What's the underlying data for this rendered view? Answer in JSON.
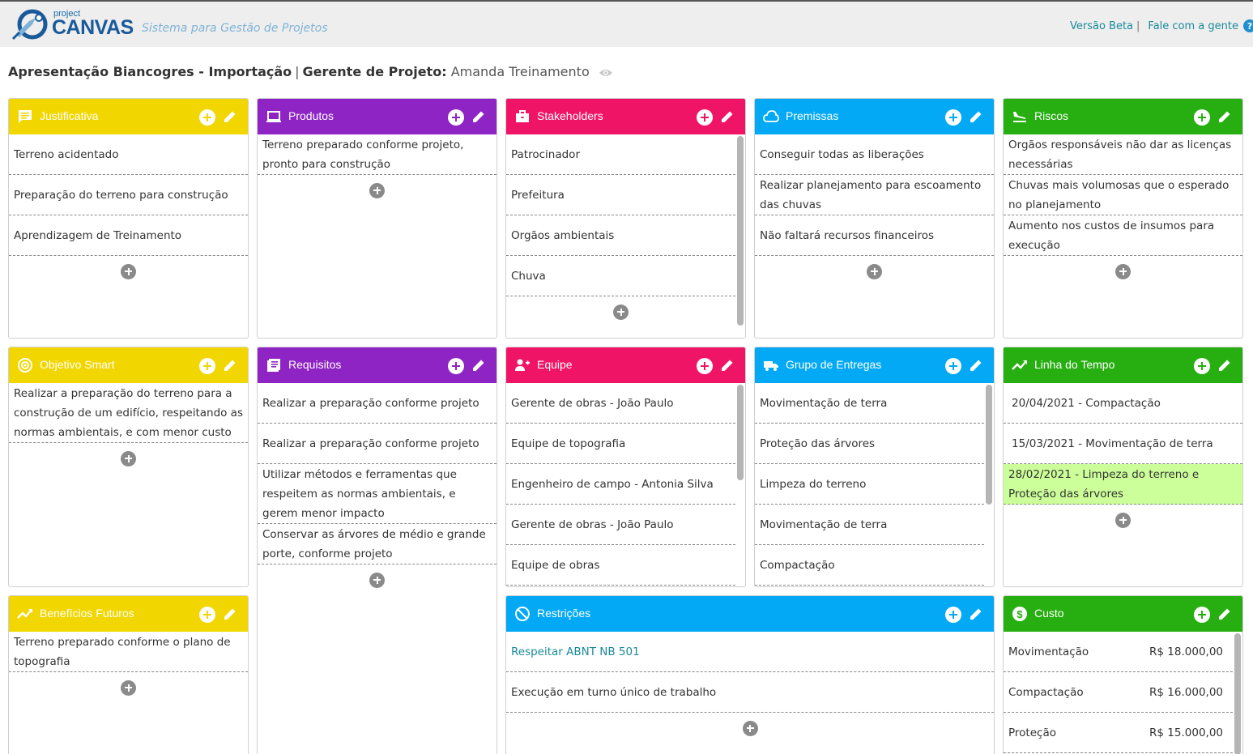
{
  "header": {
    "logo_small": "project",
    "logo_big": "CANVAS",
    "tagline": "Sistema para Gestão de Projetos",
    "version_link": "Versão Beta",
    "separator": "|",
    "contact_link": "Fale com a gente",
    "help_icon": "?"
  },
  "project": {
    "name": "Apresentação Biancogres - Importação",
    "pipe": "|",
    "manager_label": "Gerente de Projeto:",
    "manager_name": "Amanda Treinamento"
  },
  "colors": {
    "yellow": "#f2d600",
    "purple": "#8e24c4",
    "pink": "#f01466",
    "blue": "#03a9f4",
    "green": "#27ae10",
    "highlight": "#ccff99"
  },
  "cards": {
    "justificativa": {
      "title": "Justificativa",
      "icon": "chat-icon",
      "items": [
        "Terreno acidentado",
        "Preparação do terreno para construção",
        "Aprendizagem de Treinamento"
      ]
    },
    "produtos": {
      "title": "Produtos",
      "icon": "laptop-icon",
      "items": [
        "Terreno preparado conforme projeto, pronto para construção"
      ]
    },
    "stakeholders": {
      "title": "Stakeholders",
      "icon": "briefcase-icon",
      "items": [
        "Patrocinador",
        "Prefeitura",
        "Orgãos ambientais",
        "Chuva"
      ]
    },
    "premissas": {
      "title": "Premissas",
      "icon": "cloud-icon",
      "items": [
        "Conseguir todas as liberações",
        "Realizar planejamento para escoamento das chuvas",
        "Não faltará recursos financeiros"
      ]
    },
    "riscos": {
      "title": "Riscos",
      "icon": "plane-landing-icon",
      "items": [
        "Orgãos responsáveis não dar as licenças necessárias",
        "Chuvas mais volumosas que o esperado no planejamento",
        "Aumento nos custos de insumos para execução"
      ]
    },
    "objetivo": {
      "title": "Objetivo Smart",
      "icon": "target-icon",
      "items": [
        "Realizar a preparação do terreno para a construção de um edifício, respeitando as normas ambientais, e com menor custo"
      ]
    },
    "requisitos": {
      "title": "Requisitos",
      "icon": "list-icon",
      "items": [
        "Realizar a preparação conforme projeto",
        "Realizar a preparação conforme projeto",
        "Utilizar métodos e ferramentas que respeitem as normas ambientais, e gerem menor impacto",
        "Conservar as árvores de médio e grande porte, conforme projeto"
      ]
    },
    "equipe": {
      "title": "Equipe",
      "icon": "add-people-icon",
      "items": [
        "Gerente de obras - João Paulo",
        "Equipe de topografia",
        "Engenheiro de campo - Antonia Silva",
        "Gerente de obras - João Paulo",
        "Equipe de obras"
      ]
    },
    "entregas": {
      "title": "Grupo de Entregas",
      "icon": "truck-icon",
      "items": [
        "Movimentação de terra",
        "Proteção das árvores",
        "Limpeza do terreno",
        "Movimentação de terra",
        "Compactação"
      ]
    },
    "linha": {
      "title": "Linha do Tempo",
      "icon": "trend-icon",
      "items": [
        "20/04/2021 - Compactação",
        "15/03/2021 - Movimentação de terra",
        "28/02/2021 - Limpeza do terreno e Proteção das árvores"
      ]
    },
    "beneficios": {
      "title": "Benefícios Futuros",
      "icon": "trend-icon",
      "items": [
        "Terreno preparado conforme o plano de topografia"
      ]
    },
    "restricoes": {
      "title": "Restrições",
      "icon": "block-icon",
      "items": [
        "Respeitar ABNT NB 501",
        "Execução em turno único de trabalho"
      ]
    },
    "custo": {
      "title": "Custo",
      "icon": "dollar-icon",
      "items": [
        {
          "label": "Movimentação",
          "value": "R$ 18.000,00"
        },
        {
          "label": "Compactação",
          "value": "R$ 16.000,00"
        },
        {
          "label": "Proteção",
          "value": "R$ 15.000,00"
        }
      ]
    }
  }
}
